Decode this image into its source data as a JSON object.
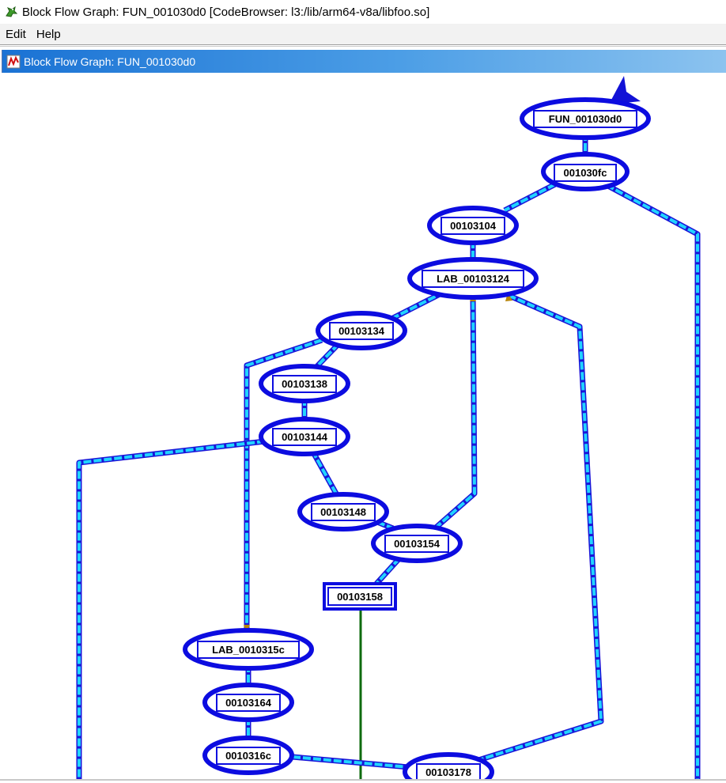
{
  "window": {
    "title": "Block Flow Graph: FUN_001030d0 [CodeBrowser: l3:/lib/arm64-v8a/libfoo.so]"
  },
  "menu": {
    "items": [
      "Edit",
      "Help"
    ]
  },
  "panel": {
    "title": "Block Flow Graph: FUN_001030d0"
  },
  "graph": {
    "nodes": [
      "FUN_001030d0",
      "001030fc",
      "00103104",
      "LAB_00103124",
      "00103134",
      "00103138",
      "00103144",
      "00103148",
      "00103154",
      "00103158",
      "LAB_0010315c",
      "00103164",
      "0010316c",
      "00103178"
    ]
  },
  "colors": {
    "edge_outline": "#1a14d8",
    "edge_fill": "#21d4ff",
    "node_outline": "#0c0ce0",
    "fallthrough_edge": "#0e6b0e",
    "panel_header": "#1a72d4"
  },
  "icons": {
    "app": "ghidra-dragon-icon",
    "panel": "block-flow-graph-icon"
  }
}
